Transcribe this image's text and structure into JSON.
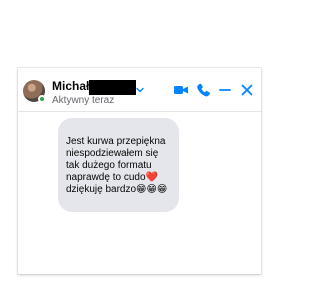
{
  "contact": {
    "name": "Michał",
    "status": "Aktywny teraz"
  },
  "icons": {
    "video": "video-icon",
    "phone": "phone-icon",
    "minimize": "minimize-icon",
    "close": "close-icon",
    "chevron": "chevron-down-icon"
  },
  "colors": {
    "accent": "#0084ff",
    "bubble": "#e4e6eb",
    "online": "#31a24c",
    "text": "#050505",
    "muted": "#65676b"
  },
  "messages": [
    {
      "text": "Jest kurwa przepiękna niespodziewałem się tak dużego formatu naprawdę to cudo❤️ dziękuję bardzo😁😁😁"
    }
  ]
}
